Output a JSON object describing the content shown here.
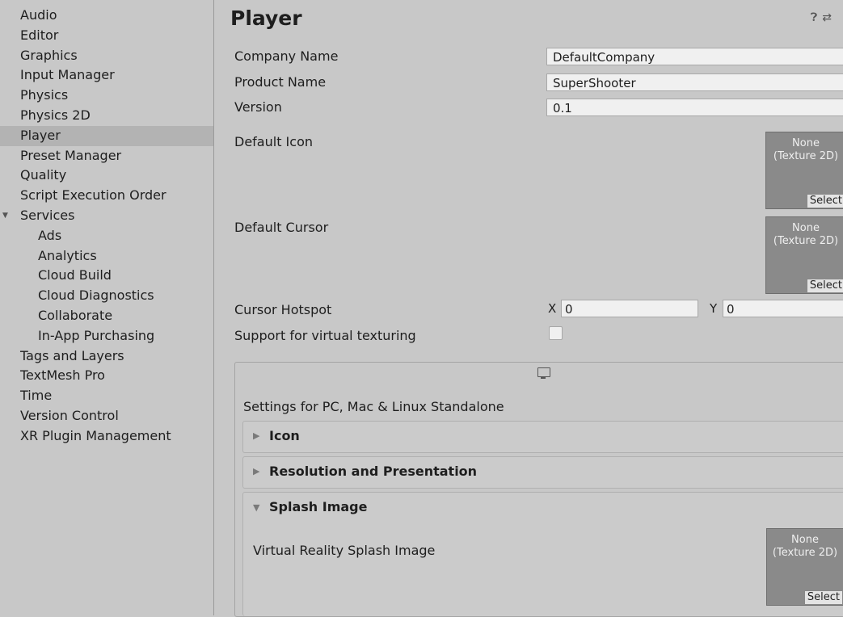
{
  "sidebar": {
    "items": [
      {
        "label": "Audio"
      },
      {
        "label": "Editor"
      },
      {
        "label": "Graphics"
      },
      {
        "label": "Input Manager"
      },
      {
        "label": "Physics"
      },
      {
        "label": "Physics 2D"
      },
      {
        "label": "Player"
      },
      {
        "label": "Preset Manager"
      },
      {
        "label": "Quality"
      },
      {
        "label": "Script Execution Order"
      },
      {
        "label": "Services"
      },
      {
        "label": "Ads"
      },
      {
        "label": "Analytics"
      },
      {
        "label": "Cloud Build"
      },
      {
        "label": "Cloud Diagnostics"
      },
      {
        "label": "Collaborate"
      },
      {
        "label": "In-App Purchasing"
      },
      {
        "label": "Tags and Layers"
      },
      {
        "label": "TextMesh Pro"
      },
      {
        "label": "Time"
      },
      {
        "label": "Version Control"
      },
      {
        "label": "XR Plugin Management"
      }
    ],
    "selected": "Player",
    "expanded_group": "Services"
  },
  "header": {
    "title": "Player",
    "icons": [
      "help-icon",
      "settings-sliders-icon"
    ]
  },
  "fields": {
    "company_name": {
      "label": "Company Name",
      "value": "DefaultCompany"
    },
    "product_name": {
      "label": "Product Name",
      "value": "SuperShooter"
    },
    "version": {
      "label": "Version",
      "value": "0.1"
    },
    "default_icon": {
      "label": "Default Icon",
      "texture": "None\n(Texture 2D)",
      "select_label": "Select"
    },
    "default_cursor": {
      "label": "Default Cursor",
      "texture": "None\n(Texture 2D)",
      "select_label": "Select"
    },
    "cursor_hotspot": {
      "label": "Cursor Hotspot",
      "x_label": "X",
      "x_value": "0",
      "y_label": "Y",
      "y_value": "0"
    },
    "virtual_texturing": {
      "label": "Support for virtual texturing",
      "checked": false
    }
  },
  "platform": {
    "icon": "monitor-icon",
    "heading": "Settings for PC, Mac & Linux Standalone",
    "sections": [
      {
        "title": "Icon",
        "expanded": false
      },
      {
        "title": "Resolution and Presentation",
        "expanded": false
      },
      {
        "title": "Splash Image",
        "expanded": true
      }
    ],
    "splash": {
      "vr_label": "Virtual Reality Splash Image",
      "texture": "None\n(Texture 2D)",
      "select_label": "Select"
    }
  }
}
